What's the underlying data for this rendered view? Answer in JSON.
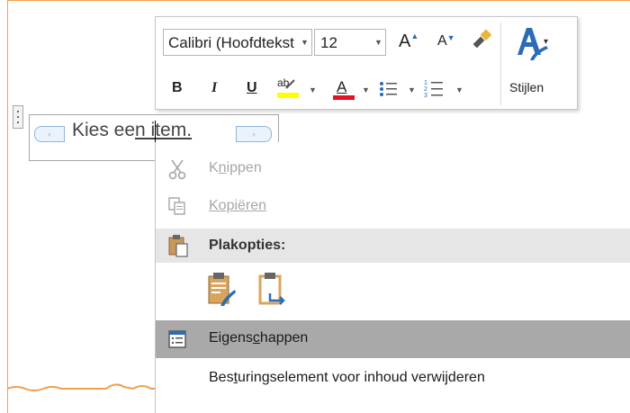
{
  "content_control": {
    "text_part1": "Kies ee",
    "text_part2": "n item."
  },
  "mini_toolbar": {
    "font_name": "Calibri (Hoofdtekst)",
    "font_size": "12",
    "grow_font": "A",
    "shrink_font": "A",
    "bold": "B",
    "italic": "I",
    "underline": "U",
    "highlight": "ab",
    "font_color": "A",
    "styles_label": "Stijlen"
  },
  "context_menu": {
    "knippen_pre": "K",
    "knippen_u": "n",
    "knippen_post": "ippen",
    "kopieren": "Kopiëren",
    "plakopties": "Plakopties:",
    "eigenschappen_pre": "Eigens",
    "eigenschappen_u": "c",
    "eigenschappen_post": "happen",
    "verwijderen_pre": "Bes",
    "verwijderen_u": "t",
    "verwijderen_post": "uringselement voor inhoud verwijderen"
  },
  "colors": {
    "page_border": "#f0a04c",
    "highlight_bar": "#ffff00",
    "font_color_bar": "#e81123",
    "menu_hover": "#a9a9a9",
    "group_header": "#e6e6e6"
  },
  "icons": [
    "scissors-icon",
    "copy-icon",
    "paste-icon",
    "paste-keep-formatting-icon",
    "paste-text-only-icon",
    "properties-icon",
    "format-painter-icon",
    "styles-icon"
  ]
}
